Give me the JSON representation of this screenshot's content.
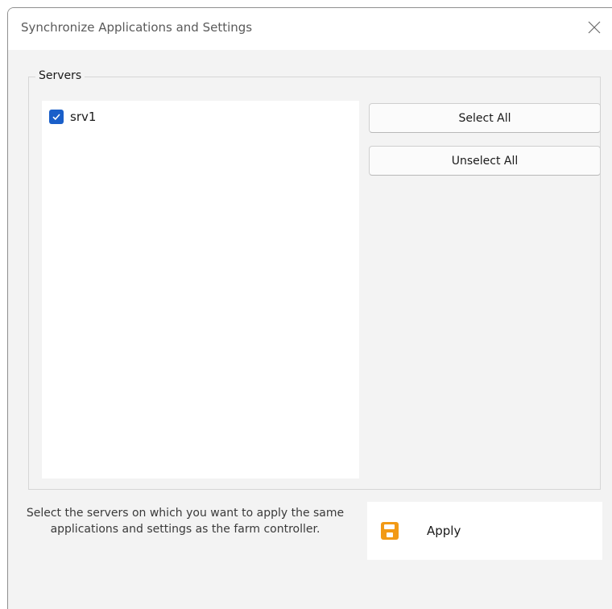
{
  "window": {
    "title": "Synchronize Applications and Settings",
    "close_icon": "close-icon"
  },
  "servers_group": {
    "legend": "Servers",
    "items": [
      {
        "label": "srv1",
        "checked": true
      }
    ]
  },
  "buttons": {
    "select_all": "Select All",
    "unselect_all": "Unselect All",
    "apply": "Apply",
    "apply_icon": "save-icon"
  },
  "hint_text": "Select the servers on which you want to apply the same applications and settings as the farm controller.",
  "colors": {
    "checkbox_accent": "#1a5fc9",
    "apply_icon": "#f29a16"
  }
}
